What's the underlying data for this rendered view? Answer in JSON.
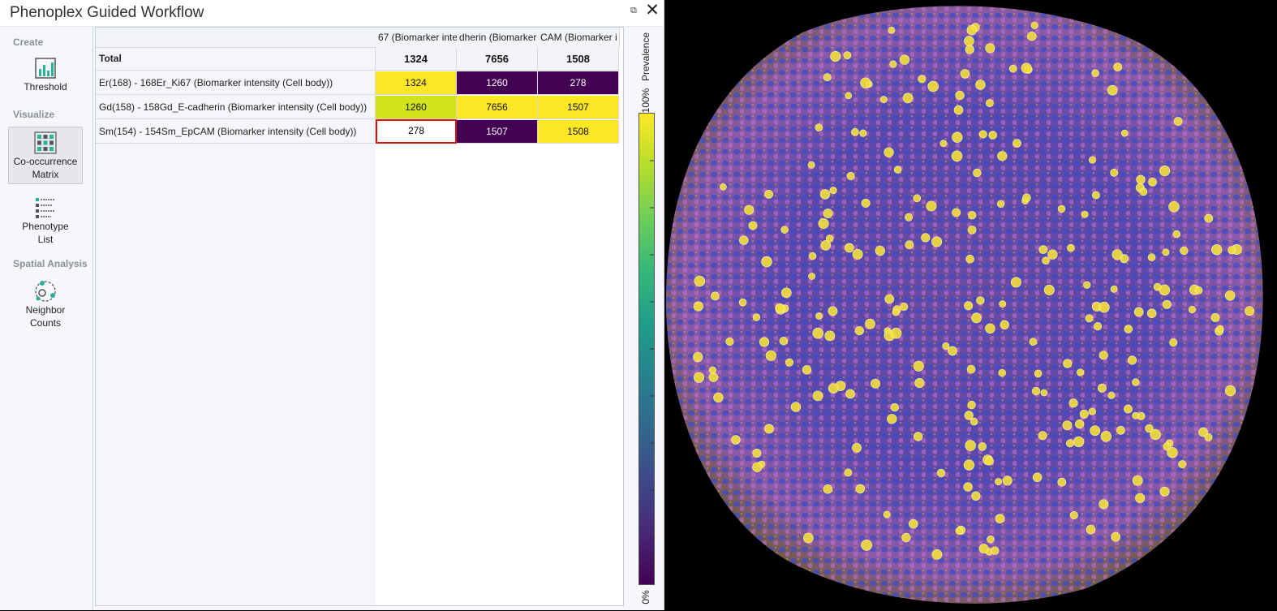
{
  "window": {
    "title": "Phenoplex Guided Workflow",
    "close_glyph": "✕",
    "dock_glyph": "⧉"
  },
  "nav": {
    "sections": {
      "create": "Create",
      "visualize": "Visualize",
      "spatial": "Spatial Analysis"
    },
    "items": {
      "threshold": "Threshold",
      "cooccurrence_line1": "Co-occurrence",
      "cooccurrence_line2": "Matrix",
      "phenotype_line1": "Phenotype",
      "phenotype_line2": "List",
      "neighbor_line1": "Neighbor",
      "neighbor_line2": "Counts"
    },
    "icons": {
      "threshold": "bar-chart-icon",
      "cooccurrence": "grid-matrix-icon",
      "phenotype": "list-icon",
      "neighbor": "neighbor-circles-icon"
    }
  },
  "matrix": {
    "column_headers": [
      "67 (Biomarker inte",
      "dherin (Biomarker",
      "CAM (Biomarker i"
    ],
    "total_label": "Total",
    "totals": [
      "1324",
      "7656",
      "1508"
    ],
    "rows": [
      {
        "label": "Er(168) - 168Er_Ki67 (Biomarker intensity (Cell body))",
        "values": [
          "1324",
          "1260",
          "278"
        ],
        "colors": [
          "#fde725",
          "#440154",
          "#440154"
        ]
      },
      {
        "label": "Gd(158) - 158Gd_E-cadherin (Biomarker intensity (Cell body))",
        "values": [
          "1260",
          "7656",
          "1507"
        ],
        "colors": [
          "#d2e21b",
          "#fde725",
          "#fde725"
        ]
      },
      {
        "label": "Sm(154) - 154Sm_EpCAM (Biomarker intensity (Cell body))",
        "values": [
          "278",
          "1507",
          "1508"
        ],
        "colors": [
          "#ffffff",
          "#440154",
          "#fde725"
        ]
      }
    ],
    "selected_cell": "row 3, column 1"
  },
  "scale": {
    "title": "Prevalence",
    "max_label": "100%",
    "min_label": "0%",
    "colors": [
      "#fde725",
      "#b5de2b",
      "#6ece58",
      "#35b779",
      "#1f9e89",
      "#26828e",
      "#31688e",
      "#3e4989",
      "#482878",
      "#440154"
    ]
  }
}
